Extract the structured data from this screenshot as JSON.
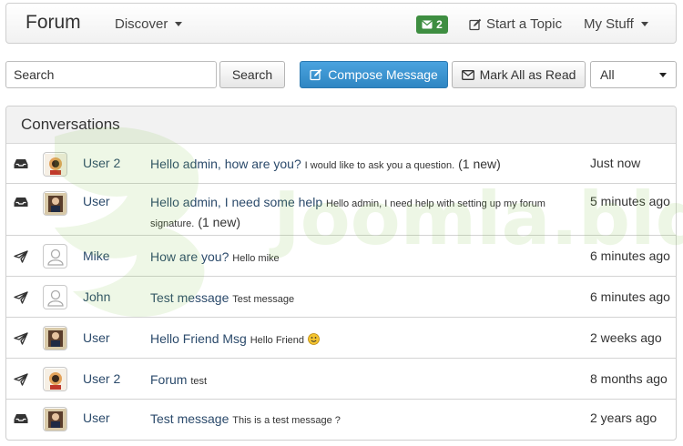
{
  "navbar": {
    "brand": "Forum",
    "discover_label": "Discover",
    "message_count": "2",
    "start_topic_label": "Start a Topic",
    "my_stuff_label": "My Stuff"
  },
  "toolbar": {
    "search_placeholder": "Search",
    "search_button": "Search",
    "compose_button": "Compose Message",
    "mark_all_button": "Mark All as Read",
    "filter_value": "All"
  },
  "panel": {
    "title": "Conversations"
  },
  "conversations": [
    {
      "direction": "inbox",
      "avatar": "avatar-user2",
      "user": "User 2",
      "subject": "Hello admin, how are you?",
      "preview": "I would like to ask you a question.",
      "new_count": "(1 new)",
      "time": "Just now"
    },
    {
      "direction": "inbox",
      "avatar": "avatar-user",
      "user": "User",
      "subject": "Hello admin, I need some help",
      "preview": "Hello admin, I need help with setting up my forum signature.",
      "new_count": "(1 new)",
      "time": "5 minutes ago"
    },
    {
      "direction": "sent",
      "avatar": "avatar-default",
      "user": "Mike",
      "subject": "How are you?",
      "preview": "Hello mike",
      "new_count": "",
      "time": "6 minutes ago"
    },
    {
      "direction": "sent",
      "avatar": "avatar-default",
      "user": "John",
      "subject": "Test message",
      "preview": "Test message",
      "new_count": "",
      "time": "6 minutes ago"
    },
    {
      "direction": "sent",
      "avatar": "avatar-user",
      "user": "User",
      "subject": "Hello Friend Msg",
      "preview": "Hello Friend",
      "new_count": "",
      "time": "2 weeks ago"
    },
    {
      "direction": "sent",
      "avatar": "avatar-user2",
      "user": "User 2",
      "subject": "Forum",
      "preview": "test",
      "new_count": "",
      "time": "8 months ago"
    },
    {
      "direction": "inbox",
      "avatar": "avatar-user",
      "user": "User",
      "subject": "Test message",
      "preview": "This is a test message ?",
      "new_count": "",
      "time": "2 years ago"
    }
  ],
  "watermark_text": "Joomla.bld",
  "colors": {
    "primary": "#2f86c3",
    "badge": "#3e8e41",
    "link": "#2b4a6b",
    "watermark": "#7cbf3f"
  }
}
